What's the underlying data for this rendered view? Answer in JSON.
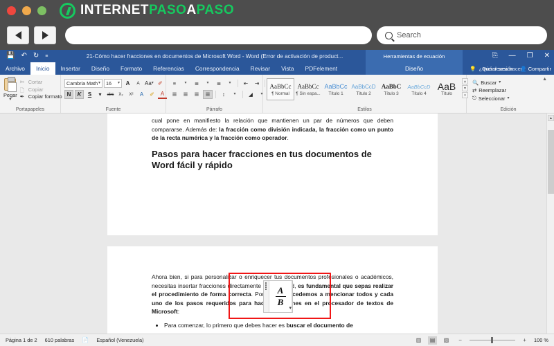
{
  "browser": {
    "brand_white": "INTERNET",
    "brand_green_1": "PASO",
    "brand_white_2": "A",
    "brand_green_2": "PASO",
    "back_label": "◀",
    "forward_label": "▶",
    "url_value": "",
    "url_placeholder": "",
    "search_placeholder": "Search",
    "traffic_colors": {
      "close": "#f0473e",
      "minimize": "#f0a94c",
      "zoom": "#7dc063"
    },
    "accent_green": "#16c95f"
  },
  "word": {
    "document_title": "21-Cómo hacer fracciones en documentos de Microsoft Word - Word (Error de activación de product...",
    "contextual_group": "Herramientas de ecuación",
    "contextual_tab": "Diseño",
    "tell_me": "¿Qué desea hacer?",
    "sign_in": "Iniciar sesión",
    "share": "Compartir",
    "titlebar_color": "#2b579a",
    "quick_access": [
      {
        "name": "save-icon",
        "glyph": "⬜"
      },
      {
        "name": "undo-icon",
        "glyph": "↶"
      },
      {
        "name": "redo-icon",
        "glyph": "↻"
      },
      {
        "name": "customize-qat-icon",
        "glyph": "≡"
      }
    ],
    "window_controls": [
      {
        "name": "ribbon-display-options-icon",
        "glyph": "⬚"
      },
      {
        "name": "minimize-icon",
        "glyph": "—"
      },
      {
        "name": "restore-icon",
        "glyph": "❐"
      },
      {
        "name": "close-icon",
        "glyph": "✕"
      }
    ],
    "tabs": [
      {
        "label": "Archivo",
        "active": false
      },
      {
        "label": "Inicio",
        "active": true
      },
      {
        "label": "Insertar",
        "active": false
      },
      {
        "label": "Diseño",
        "active": false
      },
      {
        "label": "Formato",
        "active": false
      },
      {
        "label": "Referencias",
        "active": false
      },
      {
        "label": "Correspondencia",
        "active": false
      },
      {
        "label": "Revisar",
        "active": false
      },
      {
        "label": "Vista",
        "active": false
      },
      {
        "label": "PDFelement",
        "active": false
      }
    ],
    "ribbon": {
      "clipboard": {
        "group_label": "Portapapeles",
        "paste_label": "Pegar",
        "cut_label": "Cortar",
        "copy_label": "Copiar",
        "format_painter_label": "Copiar formato"
      },
      "font": {
        "group_label": "Fuente",
        "font_name": "Cambria Math",
        "font_size": "16",
        "grow_label": "A",
        "shrink_label": "A",
        "case_label": "Aa",
        "clear_format_label": "✐",
        "bold_label": "N",
        "italic_label": "K",
        "underline_label": "S",
        "strike_label": "abc",
        "subscript_label": "X₂",
        "superscript_label": "X²",
        "text_effects_label": "A",
        "highlight_label": "✐",
        "font_color_label": "A"
      },
      "paragraph": {
        "group_label": "Párrafo"
      },
      "styles": {
        "group_label": "Estilos",
        "items": [
          {
            "preview": "AaBbCc",
            "name": "¶ Normal",
            "selected": true,
            "style": "normal"
          },
          {
            "preview": "AaBbCc",
            "name": "¶ Sin espa...",
            "selected": false,
            "style": "normal"
          },
          {
            "preview": "AaBbCc",
            "name": "Título 1",
            "selected": false,
            "style": "blue"
          },
          {
            "preview": "AaBbCcD",
            "name": "Título 2",
            "selected": false,
            "style": "blue-small"
          },
          {
            "preview": "AaBbC",
            "name": "Título 3",
            "selected": false,
            "style": "bold"
          },
          {
            "preview": "AaBbCcD",
            "name": "Título 4",
            "selected": false,
            "style": "blue-italic"
          },
          {
            "preview": "AaB",
            "name": "Título",
            "selected": false,
            "style": "large"
          }
        ]
      },
      "editing": {
        "group_label": "Edición",
        "find_label": "Buscar",
        "replace_label": "Reemplazar",
        "select_label": "Seleccionar"
      }
    },
    "document": {
      "para_1_plain_1": "cual pone en manifiesto la relación que mantienen un par de números que deben compararse. Además de: ",
      "para_1_bold": "la fracción como división indicada, la fracción como un punto de la recta numérica y la fracción como operador",
      "para_1_plain_2": ".",
      "heading": "Pasos para hacer fracciones en tus documentos de Word fácil y rápido",
      "equation_numerator": "A",
      "equation_denominator": "B",
      "para_2_plain_1": "Ahora bien, si para personalizar o enriquecer tus documentos profesionales o académicos, necesitas insertar fracciones directamente desde Word, ",
      "para_2_bold_1": "es fundamental que sepas realizar el procedimiento de forma correcta",
      "para_2_plain_2": ". Por ende, ",
      "para_2_bold_2": "procedemos a mencionar todos y cada uno de los pasos requeridos para hacer fracciones en el procesador de textos de Microsoft",
      "para_2_plain_3": ":",
      "bullet_1_plain": "Para comenzar, lo primero que debes hacer es ",
      "bullet_1_bold": "buscar el documento de"
    },
    "status": {
      "page_info": "Página 1 de 2",
      "word_count": "610 palabras",
      "proofing_icon": "proofing-errors-icon",
      "language": "Español (Venezuela)",
      "views": [
        {
          "name": "read-mode-view-button",
          "glyph": "☷",
          "selected": false
        },
        {
          "name": "print-layout-view-button",
          "glyph": "▤",
          "selected": true
        },
        {
          "name": "web-layout-view-button",
          "glyph": "▧",
          "selected": false
        }
      ],
      "zoom_out_label": "−",
      "zoom_in_label": "+",
      "zoom_level": "100 %"
    }
  }
}
